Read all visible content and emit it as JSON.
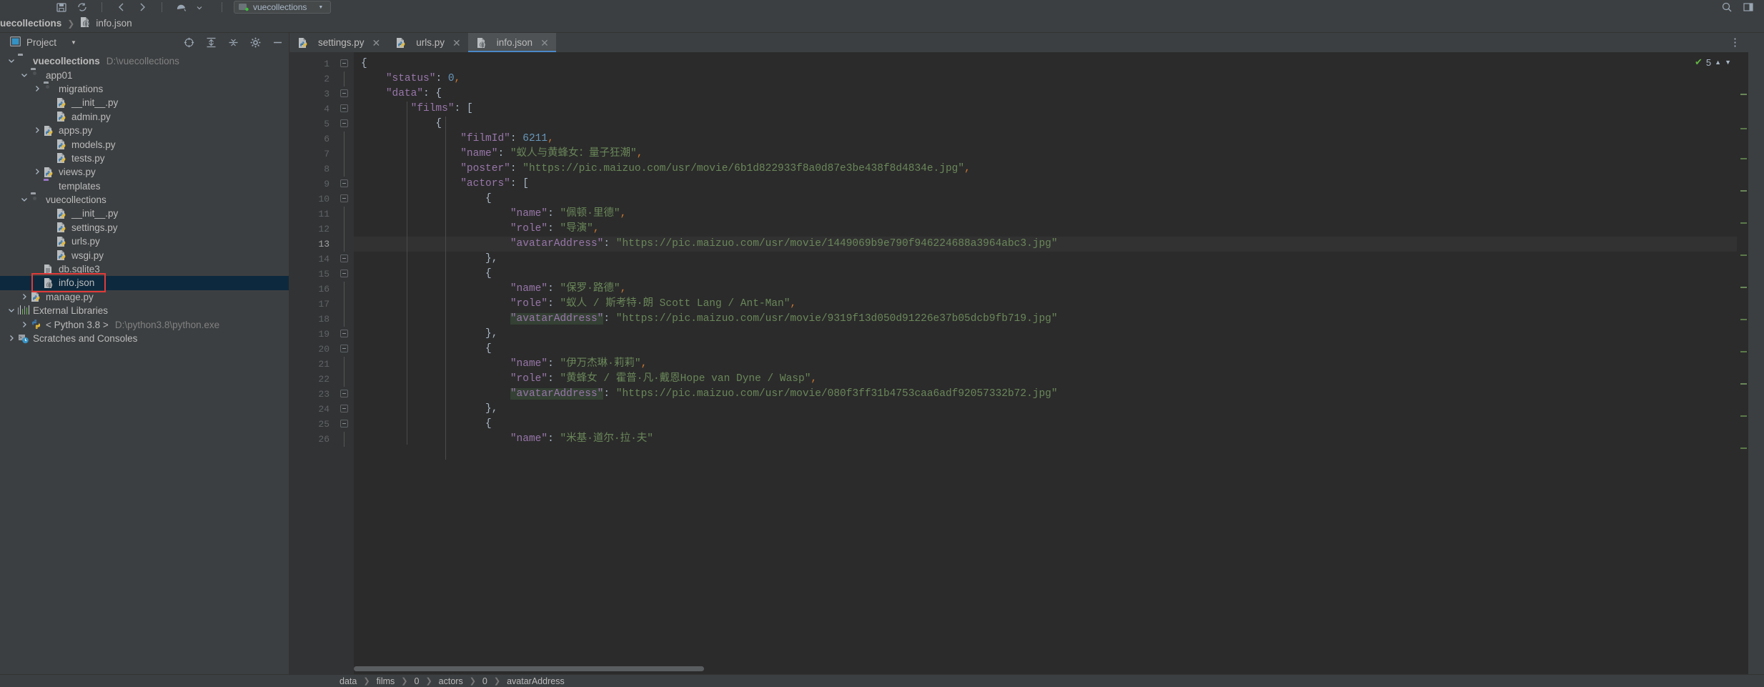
{
  "toolbar": {
    "icons": [
      "save-icon",
      "sync-icon",
      "undo-icon",
      "redo-icon",
      "vcs-update-icon"
    ],
    "run_config": "vuecollections",
    "right_icons": [
      "search-icon",
      "layout-icon"
    ]
  },
  "navbar": {
    "crumbs": [
      "uecollections",
      "info.json"
    ]
  },
  "project_panel": {
    "title": "Project",
    "actions": [
      "locate-icon",
      "expand-all-icon",
      "collapse-all-icon",
      "settings-gear-icon",
      "hide-panel-icon"
    ],
    "tree": [
      {
        "label": "vuecollections",
        "sub": "D:\\vuecollections",
        "indent": 0,
        "arrow": "down",
        "icon": "folder-gray",
        "bold": true,
        "selected": false
      },
      {
        "label": "app01",
        "sub": "",
        "indent": 1,
        "arrow": "down",
        "icon": "folder-module",
        "bold": false,
        "selected": false
      },
      {
        "label": "migrations",
        "sub": "",
        "indent": 2,
        "arrow": "right",
        "icon": "folder-module",
        "bold": false,
        "selected": false
      },
      {
        "label": "__init__.py",
        "sub": "",
        "indent": 3,
        "arrow": "none",
        "icon": "python-file",
        "bold": false,
        "selected": false
      },
      {
        "label": "admin.py",
        "sub": "",
        "indent": 3,
        "arrow": "none",
        "icon": "python-file",
        "bold": false,
        "selected": false
      },
      {
        "label": "apps.py",
        "sub": "",
        "indent": 2,
        "arrow": "right",
        "icon": "python-file",
        "bold": false,
        "selected": false
      },
      {
        "label": "models.py",
        "sub": "",
        "indent": 3,
        "arrow": "none",
        "icon": "python-file",
        "bold": false,
        "selected": false
      },
      {
        "label": "tests.py",
        "sub": "",
        "indent": 3,
        "arrow": "none",
        "icon": "python-file",
        "bold": false,
        "selected": false
      },
      {
        "label": "views.py",
        "sub": "",
        "indent": 2,
        "arrow": "right",
        "icon": "python-file",
        "bold": false,
        "selected": false
      },
      {
        "label": "templates",
        "sub": "",
        "indent": 2,
        "arrow": "none",
        "icon": "folder-purple",
        "bold": false,
        "selected": false
      },
      {
        "label": "vuecollections",
        "sub": "",
        "indent": 1,
        "arrow": "down",
        "icon": "folder-module",
        "bold": false,
        "selected": false
      },
      {
        "label": "__init__.py",
        "sub": "",
        "indent": 3,
        "arrow": "none",
        "icon": "python-file",
        "bold": false,
        "selected": false
      },
      {
        "label": "settings.py",
        "sub": "",
        "indent": 3,
        "arrow": "none",
        "icon": "python-file",
        "bold": false,
        "selected": false
      },
      {
        "label": "urls.py",
        "sub": "",
        "indent": 3,
        "arrow": "none",
        "icon": "python-file",
        "bold": false,
        "selected": false
      },
      {
        "label": "wsgi.py",
        "sub": "",
        "indent": 3,
        "arrow": "none",
        "icon": "python-file",
        "bold": false,
        "selected": false
      },
      {
        "label": "db.sqlite3",
        "sub": "",
        "indent": 2,
        "arrow": "none",
        "icon": "db-file",
        "bold": false,
        "selected": false
      },
      {
        "label": "info.json",
        "sub": "",
        "indent": 2,
        "arrow": "none",
        "icon": "json-file",
        "bold": false,
        "selected": true
      },
      {
        "label": "manage.py",
        "sub": "",
        "indent": 1,
        "arrow": "right",
        "icon": "python-file",
        "bold": false,
        "selected": false
      },
      {
        "label": "External Libraries",
        "sub": "",
        "indent": 0,
        "arrow": "down",
        "icon": "external-libraries",
        "bold": false,
        "selected": false
      },
      {
        "label": "< Python 3.8 >",
        "sub": "D:\\python3.8\\python.exe",
        "indent": 1,
        "arrow": "right",
        "icon": "python-sdk",
        "bold": false,
        "selected": false
      },
      {
        "label": "Scratches and Consoles",
        "sub": "",
        "indent": 0,
        "arrow": "right",
        "icon": "scratches",
        "bold": false,
        "selected": false
      }
    ]
  },
  "editor": {
    "tabs": [
      {
        "label": "settings.py",
        "icon": "python-file",
        "active": false
      },
      {
        "label": "urls.py",
        "icon": "python-file",
        "active": false
      },
      {
        "label": "info.json",
        "icon": "json-file",
        "active": true
      }
    ],
    "inspection_count": "5",
    "current_line": 13,
    "line_numbers": [
      1,
      2,
      3,
      4,
      5,
      6,
      7,
      8,
      9,
      10,
      11,
      12,
      13,
      14,
      15,
      16,
      17,
      18,
      19,
      20,
      21,
      22,
      23,
      24,
      25,
      26
    ],
    "lines": [
      [
        {
          "t": "{",
          "c": "pun"
        }
      ],
      [
        {
          "t": "    ",
          "c": "pun"
        },
        {
          "t": "\"status\"",
          "c": "key"
        },
        {
          "t": ": ",
          "c": "pun"
        },
        {
          "t": "0",
          "c": "num"
        },
        {
          "t": ",",
          "c": "com"
        }
      ],
      [
        {
          "t": "    ",
          "c": "pun"
        },
        {
          "t": "\"data\"",
          "c": "key"
        },
        {
          "t": ": {",
          "c": "pun"
        }
      ],
      [
        {
          "t": "        ",
          "c": "pun"
        },
        {
          "t": "\"films\"",
          "c": "key"
        },
        {
          "t": ": [",
          "c": "pun"
        }
      ],
      [
        {
          "t": "            {",
          "c": "pun"
        }
      ],
      [
        {
          "t": "                ",
          "c": "pun"
        },
        {
          "t": "\"filmId\"",
          "c": "key"
        },
        {
          "t": ": ",
          "c": "pun"
        },
        {
          "t": "6211",
          "c": "num"
        },
        {
          "t": ",",
          "c": "com"
        }
      ],
      [
        {
          "t": "                ",
          "c": "pun"
        },
        {
          "t": "\"name\"",
          "c": "key"
        },
        {
          "t": ": ",
          "c": "pun"
        },
        {
          "t": "\"蚁人与黄蜂女：量子狂潮\"",
          "c": "str"
        },
        {
          "t": ",",
          "c": "com"
        }
      ],
      [
        {
          "t": "                ",
          "c": "pun"
        },
        {
          "t": "\"poster\"",
          "c": "key"
        },
        {
          "t": ": ",
          "c": "pun"
        },
        {
          "t": "\"https://pic.maizuo.com/usr/movie/6b1d822933f8a0d87e3be438f8d4834e.jpg\"",
          "c": "str"
        },
        {
          "t": ",",
          "c": "com"
        }
      ],
      [
        {
          "t": "                ",
          "c": "pun"
        },
        {
          "t": "\"actors\"",
          "c": "key"
        },
        {
          "t": ": [",
          "c": "pun"
        }
      ],
      [
        {
          "t": "                    {",
          "c": "pun"
        }
      ],
      [
        {
          "t": "                        ",
          "c": "pun"
        },
        {
          "t": "\"name\"",
          "c": "key"
        },
        {
          "t": ": ",
          "c": "pun"
        },
        {
          "t": "\"佩顿·里德\"",
          "c": "str"
        },
        {
          "t": ",",
          "c": "com"
        }
      ],
      [
        {
          "t": "                        ",
          "c": "pun"
        },
        {
          "t": "\"role\"",
          "c": "key"
        },
        {
          "t": ": ",
          "c": "pun"
        },
        {
          "t": "\"导演\"",
          "c": "str"
        },
        {
          "t": ",",
          "c": "com"
        }
      ],
      [
        {
          "t": "                        ",
          "c": "pun"
        },
        {
          "t": "\"avatarAddress\"",
          "c": "key"
        },
        {
          "t": ": ",
          "c": "pun"
        },
        {
          "t": "\"https://pic.maizuo.com/usr/movie/1449069b9e790f946224688a3964abc3.jpg\"",
          "c": "str"
        }
      ],
      [
        {
          "t": "                    },",
          "c": "pun"
        }
      ],
      [
        {
          "t": "                    {",
          "c": "pun"
        }
      ],
      [
        {
          "t": "                        ",
          "c": "pun"
        },
        {
          "t": "\"name\"",
          "c": "key"
        },
        {
          "t": ": ",
          "c": "pun"
        },
        {
          "t": "\"保罗·路德\"",
          "c": "str"
        },
        {
          "t": ",",
          "c": "com"
        }
      ],
      [
        {
          "t": "                        ",
          "c": "pun"
        },
        {
          "t": "\"role\"",
          "c": "key"
        },
        {
          "t": ": ",
          "c": "pun"
        },
        {
          "t": "\"蚁人 / 斯考特·朗 Scott Lang / Ant-Man\"",
          "c": "str"
        },
        {
          "t": ",",
          "c": "com"
        }
      ],
      [
        {
          "t": "                        ",
          "c": "pun"
        },
        {
          "t": "\"avatarAddress\"",
          "c": "key",
          "hl": true
        },
        {
          "t": ": ",
          "c": "pun"
        },
        {
          "t": "\"https://pic.maizuo.com/usr/movie/9319f13d050d91226e37b05dcb9fb719.jpg\"",
          "c": "str"
        }
      ],
      [
        {
          "t": "                    },",
          "c": "pun"
        }
      ],
      [
        {
          "t": "                    {",
          "c": "pun"
        }
      ],
      [
        {
          "t": "                        ",
          "c": "pun"
        },
        {
          "t": "\"name\"",
          "c": "key"
        },
        {
          "t": ": ",
          "c": "pun"
        },
        {
          "t": "\"伊万杰琳·莉莉\"",
          "c": "str"
        },
        {
          "t": ",",
          "c": "com"
        }
      ],
      [
        {
          "t": "                        ",
          "c": "pun"
        },
        {
          "t": "\"role\"",
          "c": "key"
        },
        {
          "t": ": ",
          "c": "pun"
        },
        {
          "t": "\"黄蜂女 / 霍普·凡·戴恩Hope van Dyne / Wasp\"",
          "c": "str"
        },
        {
          "t": ",",
          "c": "com"
        }
      ],
      [
        {
          "t": "                        ",
          "c": "pun"
        },
        {
          "t": "\"avatarAddress\"",
          "c": "key",
          "hl": true
        },
        {
          "t": ": ",
          "c": "pun"
        },
        {
          "t": "\"https://pic.maizuo.com/usr/movie/080f3ff31b4753caa6adf92057332b72.jpg\"",
          "c": "str"
        }
      ],
      [
        {
          "t": "                    },",
          "c": "pun"
        }
      ],
      [
        {
          "t": "                    {",
          "c": "pun"
        }
      ],
      [
        {
          "t": "                        ",
          "c": "pun"
        },
        {
          "t": "\"name\"",
          "c": "key"
        },
        {
          "t": ": ",
          "c": "pun"
        },
        {
          "t": "\"米基·道尔·拉·夫\"",
          "c": "str"
        }
      ]
    ]
  },
  "bottom_breadcrumb": [
    "data",
    "films",
    "0",
    "actors",
    "0",
    "avatarAddress"
  ],
  "colors": {
    "accent": "#4a88c7",
    "selection": "#0d293e",
    "annotation_red": "#e03a3a",
    "editor_bg": "#2b2b2b",
    "panel_bg": "#3c3f41",
    "string": "#6a8759",
    "key": "#9876aa",
    "number": "#6897bb",
    "punctuation": "#a9b7c6",
    "comma": "#cc7832",
    "ok_green": "#62b543"
  }
}
